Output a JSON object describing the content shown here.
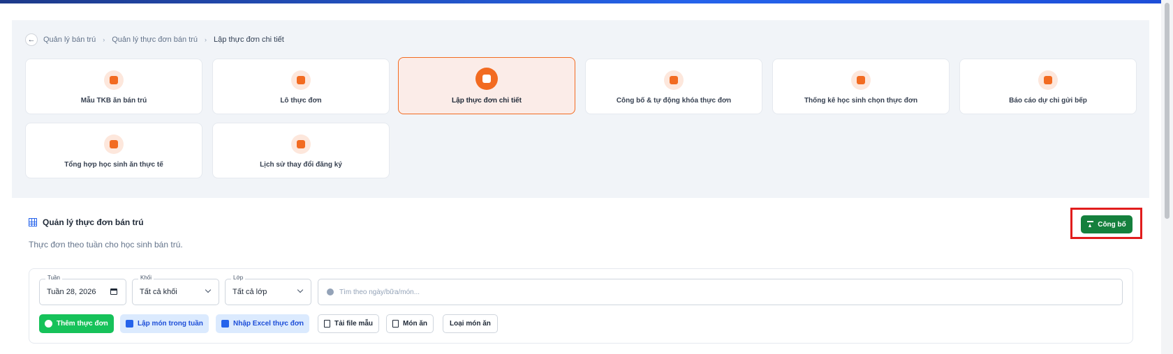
{
  "breadcrumb": {
    "items": [
      "Quản lý bán trú",
      "Quản lý thực đơn bán trú",
      "Lập thực đơn chi tiết"
    ]
  },
  "cards": [
    {
      "label": "Mẫu TKB ăn bán trú",
      "icon": "calendar-icon"
    },
    {
      "label": "Lô thực đơn",
      "icon": "box-icon"
    },
    {
      "label": "Lập thực đơn chi tiết",
      "icon": "menu-edit-icon",
      "active": true
    },
    {
      "label": "Công bố & tự động khóa thực đơn",
      "icon": "lock-icon"
    },
    {
      "label": "Thống kê học sinh chọn thực đơn",
      "icon": "stats-icon"
    },
    {
      "label": "Báo cáo dự chi gửi bếp",
      "icon": "report-icon"
    },
    {
      "label": "Tổng hợp học sinh ăn thực tế",
      "icon": "briefcase-icon"
    },
    {
      "label": "Lịch sử thay đổi đăng ký",
      "icon": "history-icon"
    }
  ],
  "section": {
    "title": "Quản lý thực đơn bán trú",
    "description": "Thực đơn theo tuần cho học sinh bán trú.",
    "publish_label": "Công bố"
  },
  "filters": {
    "week": {
      "legend": "Tuần",
      "value": "Tuần 28, 2026"
    },
    "grade": {
      "legend": "Khối",
      "value": "Tất cả khối"
    },
    "class": {
      "legend": "Lớp",
      "value": "Tất cả lớp"
    },
    "search_placeholder": "Tìm theo ngày/bữa/món..."
  },
  "actions": {
    "add_menu": "Thêm thực đơn",
    "plan_week": "Lập món trong tuần",
    "import_excel": "Nhập Excel thực đơn",
    "download_template": "Tải file mẫu",
    "dishes": "Món ăn",
    "dish_types": "Loại món ăn"
  },
  "colors": {
    "accent": "#f26b21",
    "publish": "#15803d",
    "primary_green": "#16c25a",
    "highlight": "#e11d1d"
  }
}
